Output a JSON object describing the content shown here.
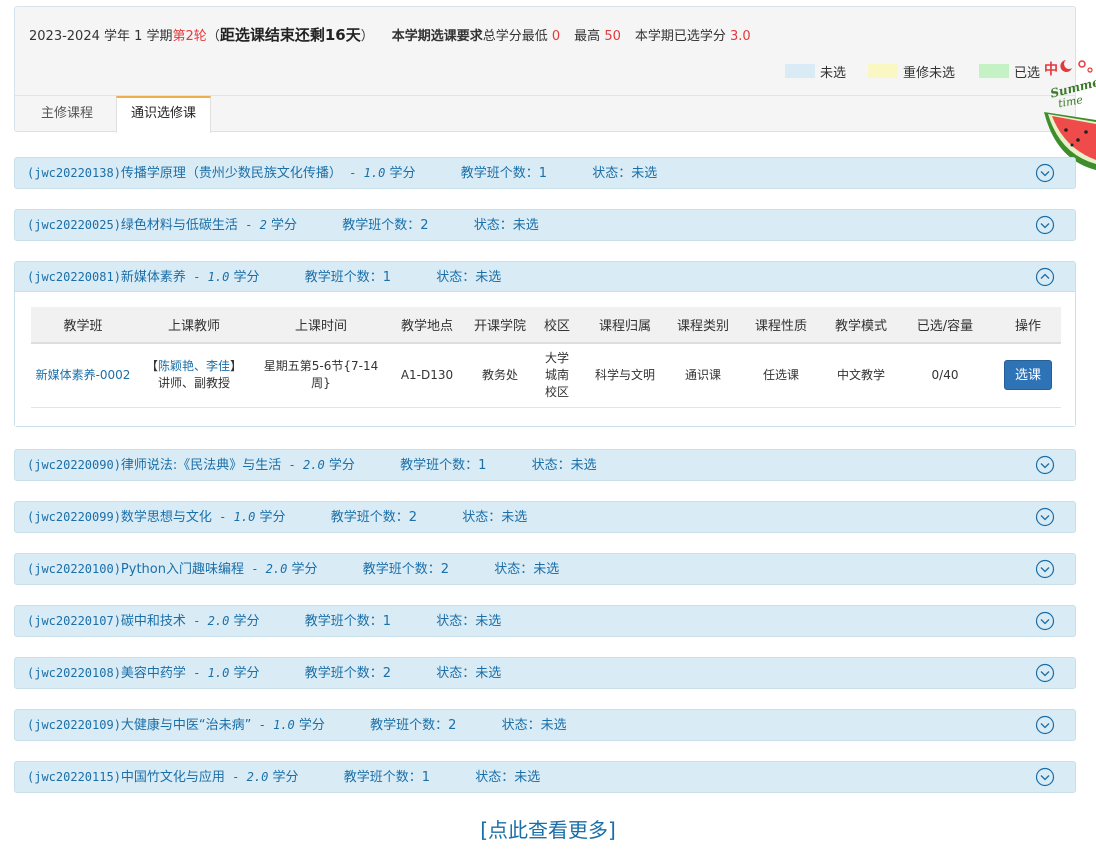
{
  "header": {
    "term": "2023-2024 学年 1 学期",
    "round": "第2轮",
    "countdown": "距选课结束还剩16天",
    "paren_open": "（",
    "paren_close": "）",
    "req_label": "本学期选课要求",
    "total_min_label": "总学分最低",
    "total_min": "0",
    "max_label": "最高",
    "max": "50",
    "selected_label": "本学期已选学分",
    "selected": "3.0"
  },
  "legend": [
    {
      "label": "未选",
      "color": "#d9ebf5"
    },
    {
      "label": "重修未选",
      "color": "#fbf7c2"
    },
    {
      "label": "已选",
      "color": "#c4f2c4"
    }
  ],
  "tabs": [
    {
      "label": "主修课程"
    },
    {
      "label": "通识选修课"
    }
  ],
  "courses": [
    {
      "code": "(jwc20220138)",
      "name": "传播学原理（贵州少数民族文化传播）",
      "credit_sep": " - ",
      "credit": "1.0",
      "credit_unit": " 学分",
      "class_count": "教学班个数：1",
      "status": "状态：未选"
    },
    {
      "code": "(jwc20220025)",
      "name": "绿色材料与低碳生活",
      "credit_sep": " - ",
      "credit": "2",
      "credit_unit": " 学分",
      "class_count": "教学班个数：2",
      "status": "状态：未选"
    },
    {
      "code": "(jwc20220081)",
      "name": "新媒体素养",
      "credit_sep": " - ",
      "credit": "1.0",
      "credit_unit": " 学分",
      "class_count": "教学班个数：1",
      "status": "状态：未选"
    },
    {
      "code": "(jwc20220090)",
      "name": "律师说法:《民法典》与生活",
      "credit_sep": " - ",
      "credit": "2.0",
      "credit_unit": " 学分",
      "class_count": "教学班个数：1",
      "status": "状态：未选"
    },
    {
      "code": "(jwc20220099)",
      "name": "数学思想与文化",
      "credit_sep": " - ",
      "credit": "1.0",
      "credit_unit": " 学分",
      "class_count": "教学班个数：2",
      "status": "状态：未选"
    },
    {
      "code": "(jwc20220100)",
      "name": "Python入门趣味编程",
      "credit_sep": " - ",
      "credit": "2.0",
      "credit_unit": " 学分",
      "class_count": "教学班个数：2",
      "status": "状态：未选"
    },
    {
      "code": "(jwc20220107)",
      "name": "碳中和技术",
      "credit_sep": " - ",
      "credit": "2.0",
      "credit_unit": " 学分",
      "class_count": "教学班个数：1",
      "status": "状态：未选"
    },
    {
      "code": "(jwc20220108)",
      "name": "美容中药学",
      "credit_sep": " - ",
      "credit": "1.0",
      "credit_unit": " 学分",
      "class_count": "教学班个数：2",
      "status": "状态：未选"
    },
    {
      "code": "(jwc20220109)",
      "name": "大健康与中医“治未病”",
      "credit_sep": " - ",
      "credit": "1.0",
      "credit_unit": " 学分",
      "class_count": "教学班个数：2",
      "status": "状态：未选"
    },
    {
      "code": "(jwc20220115)",
      "name": "中国竹文化与应用",
      "credit_sep": " - ",
      "credit": "2.0",
      "credit_unit": " 学分",
      "class_count": "教学班个数：1",
      "status": "状态：未选"
    }
  ],
  "class_table": {
    "headers": [
      "教学班",
      "上课教师",
      "上课时间",
      "教学地点",
      "开课学院",
      "校区",
      "课程归属",
      "课程类别",
      "课程性质",
      "教学模式",
      "已选/容量",
      "操作"
    ],
    "row": {
      "class_name": "新媒体素养-0002",
      "teacher_open": "【",
      "teacher_names": "陈颖艳、李佳",
      "teacher_close": "】",
      "teacher_titles": "讲师、副教授",
      "time": "星期五第5-6节{7-14周}",
      "location": "A1-D130",
      "college": "教务处",
      "campus_1": "大学",
      "campus_2": "城南",
      "campus_3": "校区",
      "belong": "科学与文明",
      "category": "通识课",
      "nature": "任选课",
      "mode": "中文教学",
      "capacity": "0/40",
      "action": "选课"
    }
  },
  "decoration": {
    "text_1": "中",
    "text_2": "Summer",
    "text_3": "time"
  },
  "more_link": "[点此查看更多]"
}
